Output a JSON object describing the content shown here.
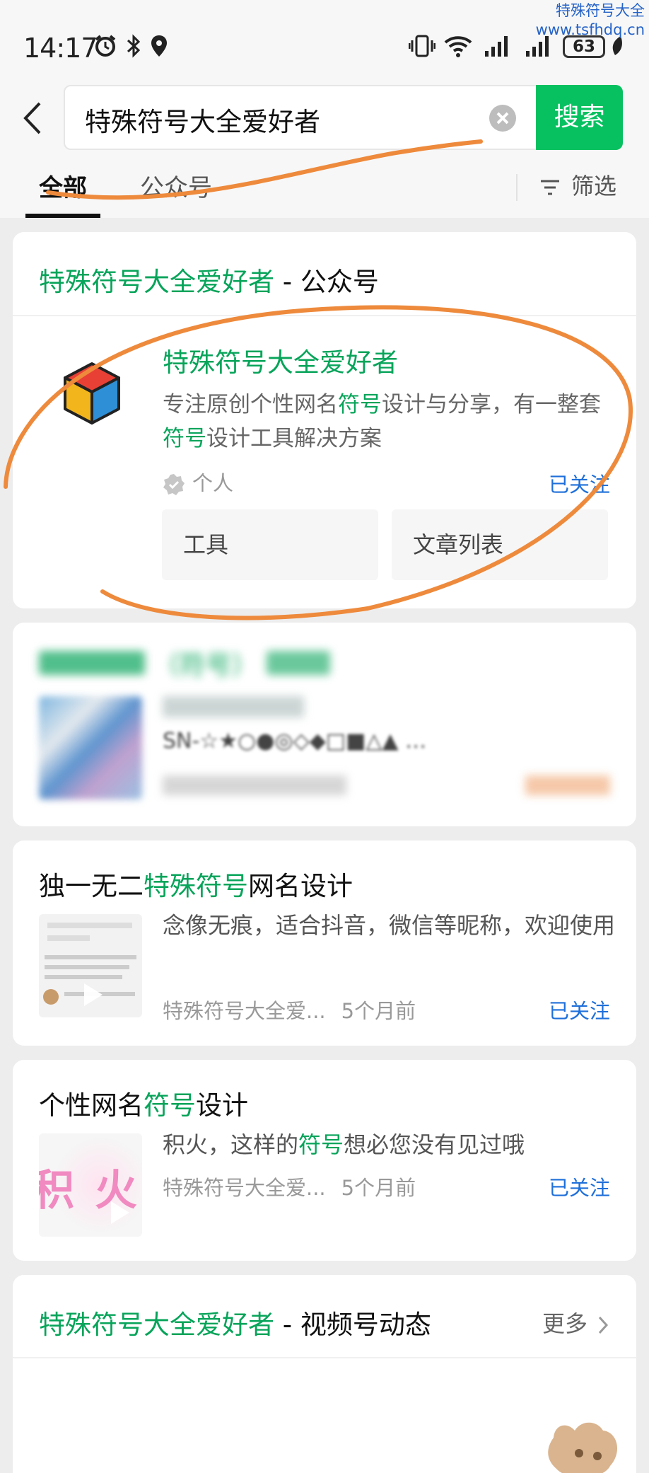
{
  "watermark": {
    "line1": "特殊符号大全",
    "line2": "www.tsfhdq.cn"
  },
  "status_bar": {
    "time": "14:17",
    "battery": "63"
  },
  "search": {
    "query": "特殊符号大全爱好者",
    "button_label": "搜索"
  },
  "tabs": {
    "all": "全部",
    "official_accounts": "公众号",
    "filter": "筛选"
  },
  "account_card": {
    "header_name": "特殊符号大全爱好者",
    "header_suffix": " - 公众号",
    "name": "特殊符号大全爱好者",
    "desc_p1": "专注原创个性网名",
    "desc_k1": "符号",
    "desc_p2": "设计与分享，有一整套",
    "desc_k2": "符号",
    "desc_p3": "设计工具解决方案",
    "type": "个人",
    "follow_status": "已关注",
    "btn_tools": "工具",
    "btn_articles": "文章列表"
  },
  "blurred_card": {
    "title_mid": "（符号）",
    "snippet": "SN-☆★○●◎◇◆□■△▲ …"
  },
  "article1": {
    "title_p1": "独一无二",
    "title_k": "特殊符号",
    "title_p2": "网名设计",
    "desc": "念像无痕，适合抖音，微信等昵称，欢迎使用",
    "source": "特殊符号大全爱...",
    "time": "5个月前",
    "follow_status": "已关注"
  },
  "article2": {
    "title_p1": "个性网名",
    "title_k": "符号",
    "title_p2": "设计",
    "desc_p1": "积火，这样的",
    "desc_k": "符号",
    "desc_p2": "想必您没有见过哦",
    "thumb_text": "积 火",
    "source": "特殊符号大全爱...",
    "time": "5个月前",
    "follow_status": "已关注"
  },
  "channels_card": {
    "header_name": "特殊符号大全爱好者",
    "header_suffix": " - 视频号动态",
    "more": "更多"
  },
  "colors": {
    "accent_green": "#07c160",
    "link_blue": "#1e6fd9",
    "annotation_orange": "#ee8a3c"
  }
}
